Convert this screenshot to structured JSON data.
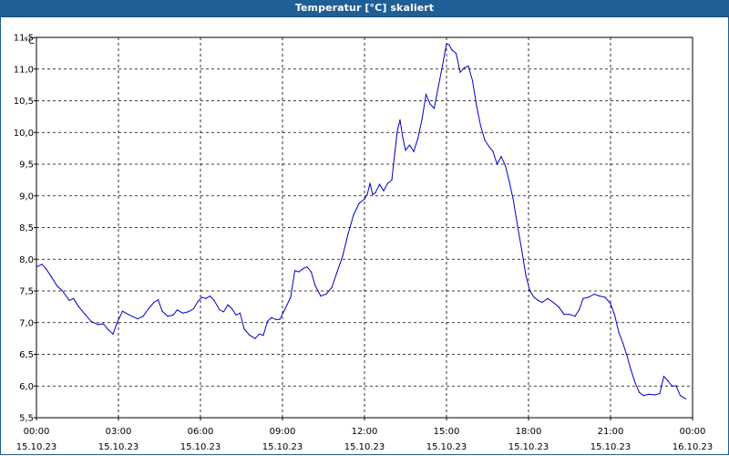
{
  "window": {
    "title": "Temperatur [°C] skaliert"
  },
  "colors": {
    "titlebar": "#1f5f96",
    "line": "#0000c8",
    "grid": "#000000"
  },
  "chart_data": {
    "type": "line",
    "title": "Temperatur [°C] skaliert",
    "ylabel": "°C",
    "xlabel": "",
    "ylim": [
      5.5,
      11.5
    ],
    "xlim": [
      0,
      24
    ],
    "grid": true,
    "legend": "none",
    "y_ticks": [
      "5,5",
      "6,0",
      "6,5",
      "7,0",
      "7,5",
      "8,0",
      "8,5",
      "9,0",
      "9,5",
      "10,0",
      "10,5",
      "11,0",
      "11,5"
    ],
    "x_ticks": [
      {
        "time": "00:00",
        "date": "15.10.23"
      },
      {
        "time": "03:00",
        "date": "15.10.23"
      },
      {
        "time": "06:00",
        "date": "15.10.23"
      },
      {
        "time": "09:00",
        "date": "15.10.23"
      },
      {
        "time": "12:00",
        "date": "15.10.23"
      },
      {
        "time": "15:00",
        "date": "15.10.23"
      },
      {
        "time": "18:00",
        "date": "15.10.23"
      },
      {
        "time": "21:00",
        "date": "15.10.23"
      },
      {
        "time": "00:00",
        "date": "16.10.23"
      }
    ],
    "series": [
      {
        "points": [
          [
            0.0,
            7.88
          ],
          [
            0.2,
            7.92
          ],
          [
            0.35,
            7.85
          ],
          [
            0.55,
            7.72
          ],
          [
            0.75,
            7.58
          ],
          [
            0.95,
            7.5
          ],
          [
            1.2,
            7.35
          ],
          [
            1.35,
            7.38
          ],
          [
            1.55,
            7.25
          ],
          [
            1.8,
            7.12
          ],
          [
            2.0,
            7.02
          ],
          [
            2.25,
            6.97
          ],
          [
            2.45,
            6.98
          ],
          [
            2.6,
            6.9
          ],
          [
            2.8,
            6.82
          ],
          [
            2.95,
            7.0
          ],
          [
            3.15,
            7.18
          ],
          [
            3.4,
            7.12
          ],
          [
            3.7,
            7.06
          ],
          [
            3.9,
            7.1
          ],
          [
            4.1,
            7.22
          ],
          [
            4.3,
            7.32
          ],
          [
            4.45,
            7.36
          ],
          [
            4.6,
            7.18
          ],
          [
            4.8,
            7.1
          ],
          [
            5.0,
            7.12
          ],
          [
            5.15,
            7.2
          ],
          [
            5.35,
            7.15
          ],
          [
            5.55,
            7.17
          ],
          [
            5.75,
            7.22
          ],
          [
            5.9,
            7.33
          ],
          [
            6.05,
            7.4
          ],
          [
            6.2,
            7.38
          ],
          [
            6.35,
            7.42
          ],
          [
            6.5,
            7.35
          ],
          [
            6.7,
            7.2
          ],
          [
            6.85,
            7.17
          ],
          [
            7.0,
            7.28
          ],
          [
            7.15,
            7.22
          ],
          [
            7.3,
            7.12
          ],
          [
            7.45,
            7.15
          ],
          [
            7.6,
            6.9
          ],
          [
            7.8,
            6.8
          ],
          [
            8.0,
            6.75
          ],
          [
            8.15,
            6.82
          ],
          [
            8.3,
            6.8
          ],
          [
            8.45,
            7.02
          ],
          [
            8.6,
            7.08
          ],
          [
            8.75,
            7.05
          ],
          [
            8.9,
            7.05
          ],
          [
            9.1,
            7.22
          ],
          [
            9.3,
            7.4
          ],
          [
            9.45,
            7.82
          ],
          [
            9.6,
            7.8
          ],
          [
            9.75,
            7.85
          ],
          [
            9.9,
            7.88
          ],
          [
            10.05,
            7.8
          ],
          [
            10.2,
            7.58
          ],
          [
            10.4,
            7.42
          ],
          [
            10.6,
            7.45
          ],
          [
            10.8,
            7.55
          ],
          [
            11.0,
            7.8
          ],
          [
            11.2,
            8.05
          ],
          [
            11.4,
            8.4
          ],
          [
            11.6,
            8.7
          ],
          [
            11.8,
            8.88
          ],
          [
            12.0,
            8.95
          ],
          [
            12.1,
            9.02
          ],
          [
            12.2,
            9.2
          ],
          [
            12.3,
            9.02
          ],
          [
            12.4,
            9.05
          ],
          [
            12.55,
            9.18
          ],
          [
            12.7,
            9.08
          ],
          [
            12.85,
            9.2
          ],
          [
            13.0,
            9.25
          ],
          [
            13.1,
            9.65
          ],
          [
            13.2,
            10.02
          ],
          [
            13.3,
            10.2
          ],
          [
            13.4,
            9.92
          ],
          [
            13.5,
            9.72
          ],
          [
            13.65,
            9.8
          ],
          [
            13.8,
            9.7
          ],
          [
            13.95,
            9.9
          ],
          [
            14.1,
            10.2
          ],
          [
            14.25,
            10.6
          ],
          [
            14.4,
            10.45
          ],
          [
            14.55,
            10.38
          ],
          [
            14.7,
            10.72
          ],
          [
            14.85,
            11.05
          ],
          [
            15.0,
            11.4
          ],
          [
            15.1,
            11.38
          ],
          [
            15.2,
            11.3
          ],
          [
            15.35,
            11.25
          ],
          [
            15.5,
            10.95
          ],
          [
            15.65,
            11.02
          ],
          [
            15.8,
            11.05
          ],
          [
            15.95,
            10.82
          ],
          [
            16.1,
            10.42
          ],
          [
            16.25,
            10.1
          ],
          [
            16.4,
            9.88
          ],
          [
            16.55,
            9.78
          ],
          [
            16.7,
            9.7
          ],
          [
            16.85,
            9.5
          ],
          [
            17.0,
            9.62
          ],
          [
            17.15,
            9.48
          ],
          [
            17.3,
            9.22
          ],
          [
            17.45,
            8.92
          ],
          [
            17.6,
            8.52
          ],
          [
            17.75,
            8.15
          ],
          [
            17.9,
            7.75
          ],
          [
            18.05,
            7.5
          ],
          [
            18.2,
            7.4
          ],
          [
            18.35,
            7.35
          ],
          [
            18.5,
            7.32
          ],
          [
            18.7,
            7.38
          ],
          [
            18.9,
            7.32
          ],
          [
            19.1,
            7.25
          ],
          [
            19.3,
            7.13
          ],
          [
            19.5,
            7.13
          ],
          [
            19.7,
            7.1
          ],
          [
            19.85,
            7.2
          ],
          [
            20.0,
            7.38
          ],
          [
            20.2,
            7.4
          ],
          [
            20.4,
            7.45
          ],
          [
            20.6,
            7.42
          ],
          [
            20.8,
            7.4
          ],
          [
            21.0,
            7.3
          ],
          [
            21.15,
            7.12
          ],
          [
            21.3,
            6.85
          ],
          [
            21.45,
            6.68
          ],
          [
            21.6,
            6.48
          ],
          [
            21.75,
            6.25
          ],
          [
            21.9,
            6.05
          ],
          [
            22.05,
            5.9
          ],
          [
            22.2,
            5.85
          ],
          [
            22.4,
            5.87
          ],
          [
            22.6,
            5.86
          ],
          [
            22.8,
            5.88
          ],
          [
            22.95,
            6.15
          ],
          [
            23.1,
            6.08
          ],
          [
            23.25,
            6.0
          ],
          [
            23.4,
            6.0
          ],
          [
            23.55,
            5.85
          ],
          [
            23.75,
            5.8
          ]
        ]
      }
    ]
  }
}
